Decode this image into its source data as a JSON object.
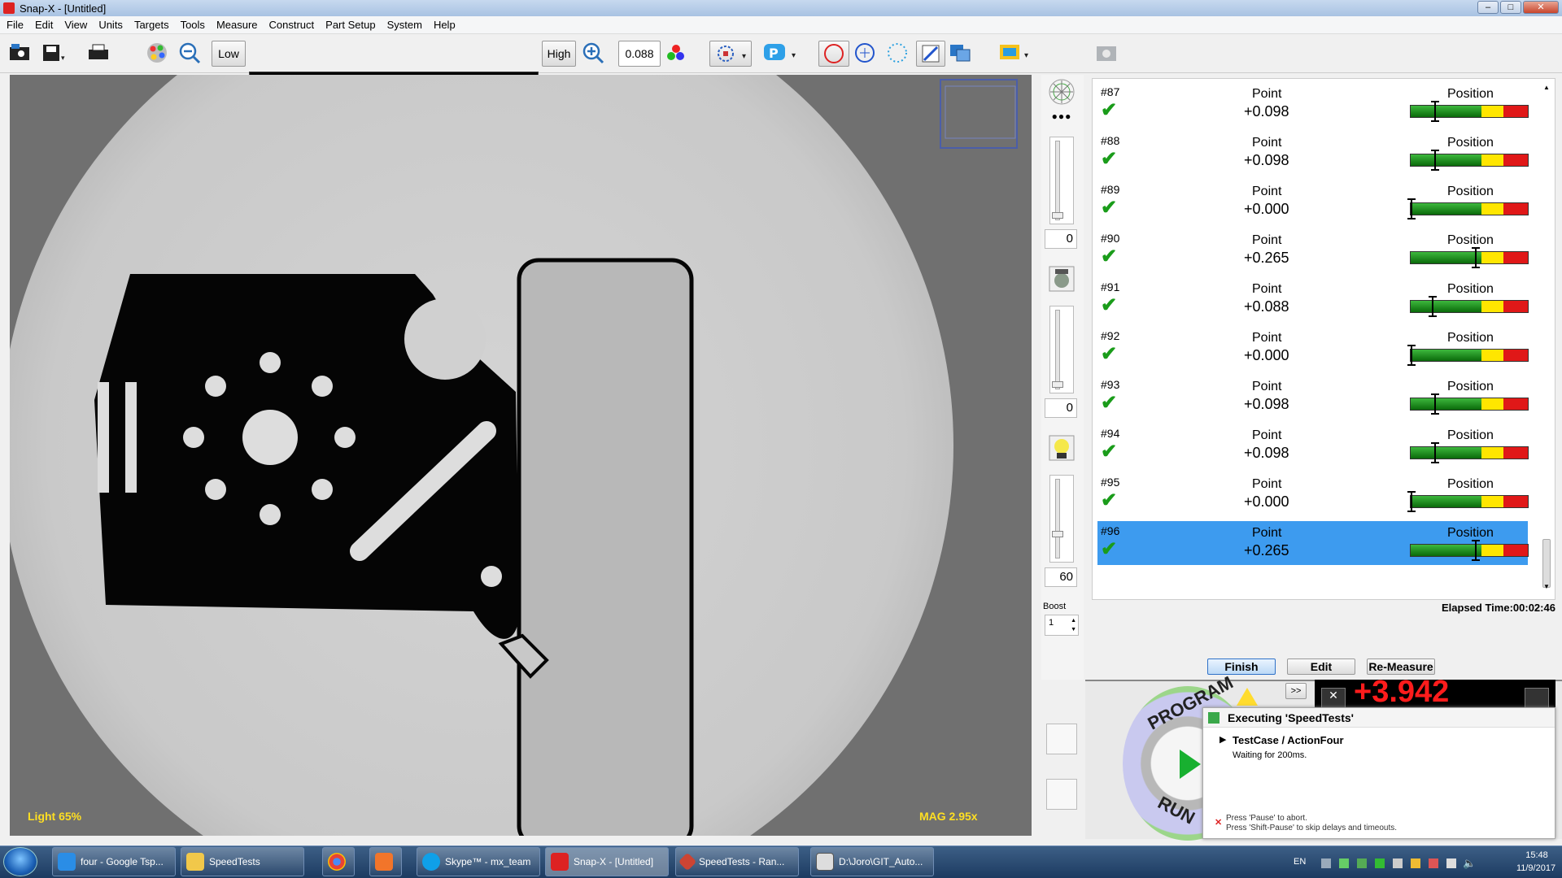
{
  "window": {
    "title": "Snap-X - [Untitled]"
  },
  "menu": [
    "File",
    "Edit",
    "View",
    "Units",
    "Targets",
    "Tools",
    "Measure",
    "Construct",
    "Part Setup",
    "System",
    "Help"
  ],
  "toolbar": {
    "low_label": "Low",
    "high_label": "High",
    "zoom_value": "0.088",
    "icons": [
      "open-camera-icon",
      "save-icon",
      "print-icon",
      "color-palette-icon",
      "zoom-out-icon",
      "zoom-in-icon",
      "rgb-icon",
      "selection-icon",
      "program-icon",
      "circle-icon",
      "crosshair-circle-icon",
      "dotted-circle-icon",
      "edge-tool-icon",
      "overlay-icon",
      "display-icon"
    ]
  },
  "viewport": {
    "light_label": "Light  65%",
    "mag_label": "MAG 2.95x"
  },
  "sidepanel": {
    "slider1_value": "0",
    "slider2_value": "0",
    "slider3_value": "60",
    "boost_label": "Boost",
    "boost_value": "1"
  },
  "measurements": [
    {
      "id": "#87",
      "type": "Point",
      "value": "+0.098",
      "status_label": "Position",
      "fraction": 0.2
    },
    {
      "id": "#88",
      "type": "Point",
      "value": "+0.098",
      "status_label": "Position",
      "fraction": 0.2
    },
    {
      "id": "#89",
      "type": "Point",
      "value": "+0.000",
      "status_label": "Position",
      "fraction": 0.0
    },
    {
      "id": "#90",
      "type": "Point",
      "value": "+0.265",
      "status_label": "Position",
      "fraction": 0.55
    },
    {
      "id": "#91",
      "type": "Point",
      "value": "+0.088",
      "status_label": "Position",
      "fraction": 0.18
    },
    {
      "id": "#92",
      "type": "Point",
      "value": "+0.000",
      "status_label": "Position",
      "fraction": 0.0
    },
    {
      "id": "#93",
      "type": "Point",
      "value": "+0.098",
      "status_label": "Position",
      "fraction": 0.2
    },
    {
      "id": "#94",
      "type": "Point",
      "value": "+0.098",
      "status_label": "Position",
      "fraction": 0.2
    },
    {
      "id": "#95",
      "type": "Point",
      "value": "+0.000",
      "status_label": "Position",
      "fraction": 0.0
    },
    {
      "id": "#96",
      "type": "Point",
      "value": "+0.265",
      "status_label": "Position",
      "fraction": 0.55,
      "selected": true
    }
  ],
  "elapsed": "Elapsed Time:00:02:46",
  "actions": {
    "finish": "Finish",
    "edit": "Edit",
    "remeasure": "Re-Measure"
  },
  "program_dial": {
    "top_text": "PROGRAM",
    "bottom_text": "RUN",
    "forward_button": ">>"
  },
  "readout": "+3.942",
  "popup": {
    "title": "Executing 'SpeedTests'",
    "testcase": "TestCase / ActionFour",
    "status": "Waiting for 200ms.",
    "help1": "Press 'Pause' to abort.",
    "help2": "Press 'Shift-Pause' to skip delays and timeouts."
  },
  "taskbar": {
    "items": [
      "four - Google Tsp...",
      "SpeedTests",
      "",
      "",
      "Skype™ - mx_team",
      "Snap-X - [Untitled]",
      "SpeedTests - Ran...",
      "D:\\Joro\\GIT_Auto..."
    ],
    "lang": "EN",
    "time": "15:48",
    "date": "11/9/2017"
  },
  "colors": {
    "selected_row": "#3d9bef",
    "check": "#1a9c1a",
    "readout": "#ff1c1c",
    "overlay_text": "#ffdf22"
  }
}
